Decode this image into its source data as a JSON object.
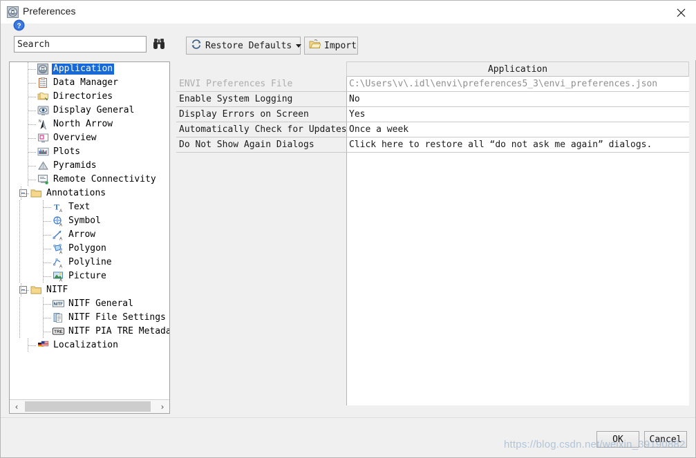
{
  "window": {
    "title": "Preferences",
    "icon": "envi-app-icon",
    "close_label": "×"
  },
  "search": {
    "value": "Search",
    "placeholder": "Search",
    "icon": "binoculars-icon"
  },
  "toolbar": {
    "restore_defaults_label": "Restore Defaults",
    "restore_defaults_icon": "refresh-icon",
    "import_label": "Import",
    "import_icon": "open-folder-icon"
  },
  "tree": {
    "items": [
      {
        "label": "Application",
        "icon": "envi-app-icon",
        "depth": 1,
        "selected": true,
        "expander": false
      },
      {
        "label": "Data Manager",
        "icon": "clipboard-icon",
        "depth": 1,
        "selected": false,
        "expander": false
      },
      {
        "label": "Directories",
        "icon": "folders-icon",
        "depth": 1,
        "selected": false,
        "expander": false
      },
      {
        "label": "Display General",
        "icon": "eye-monitor-icon",
        "depth": 1,
        "selected": false,
        "expander": false
      },
      {
        "label": "North Arrow",
        "icon": "north-arrow-icon",
        "depth": 1,
        "selected": false,
        "expander": false
      },
      {
        "label": "Overview",
        "icon": "overview-icon",
        "depth": 1,
        "selected": false,
        "expander": false
      },
      {
        "label": "Plots",
        "icon": "plots-icon",
        "depth": 1,
        "selected": false,
        "expander": false
      },
      {
        "label": "Pyramids",
        "icon": "pyramid-icon",
        "depth": 1,
        "selected": false,
        "expander": false
      },
      {
        "label": "Remote Connectivity",
        "icon": "remote-monitor-icon",
        "depth": 1,
        "selected": false,
        "expander": false
      },
      {
        "label": "Annotations",
        "icon": "folder-icon",
        "depth": 0,
        "selected": false,
        "expander": true
      },
      {
        "label": "Text",
        "icon": "text-annotation-icon",
        "depth": 2,
        "selected": false,
        "expander": false
      },
      {
        "label": "Symbol",
        "icon": "symbol-annotation-icon",
        "depth": 2,
        "selected": false,
        "expander": false
      },
      {
        "label": "Arrow",
        "icon": "arrow-annotation-icon",
        "depth": 2,
        "selected": false,
        "expander": false
      },
      {
        "label": "Polygon",
        "icon": "polygon-annotation-icon",
        "depth": 2,
        "selected": false,
        "expander": false
      },
      {
        "label": "Polyline",
        "icon": "polyline-annotation-icon",
        "depth": 2,
        "selected": false,
        "expander": false
      },
      {
        "label": "Picture",
        "icon": "picture-annotation-icon",
        "depth": 2,
        "selected": false,
        "expander": false
      },
      {
        "label": "NITF",
        "icon": "folder-icon",
        "depth": 0,
        "selected": false,
        "expander": true
      },
      {
        "label": "NITF General",
        "icon": "nitf-icon",
        "depth": 2,
        "selected": false,
        "expander": false
      },
      {
        "label": "NITF File Settings",
        "icon": "nitf-file-icon",
        "depth": 2,
        "selected": false,
        "expander": false
      },
      {
        "label": "NITF PIA TRE Metadata",
        "icon": "tre-icon",
        "depth": 2,
        "selected": false,
        "expander": false
      },
      {
        "label": "Localization",
        "icon": "flags-icon",
        "depth": 1,
        "selected": false,
        "expander": false
      }
    ],
    "hscroll": {
      "left_arrow": "‹",
      "right_arrow": "›"
    }
  },
  "preferences": {
    "column_header": "Application",
    "rows": [
      {
        "key": "ENVI Preferences File",
        "value": "C:\\Users\\v\\.idl\\envi\\preferences5_3\\envi_preferences.json",
        "disabled": true
      },
      {
        "key": "Enable System Logging",
        "value": "No",
        "disabled": false
      },
      {
        "key": "Display Errors on Screen",
        "value": "Yes",
        "disabled": false
      },
      {
        "key": "Automatically Check for Updates",
        "value": "Once a week",
        "disabled": false
      },
      {
        "key": "Do Not Show Again Dialogs",
        "value": "Click here to restore all “do not ask me again” dialogs.",
        "disabled": false
      }
    ]
  },
  "footer": {
    "help_icon": "help-circle-icon",
    "ok_label": "OK",
    "cancel_label": "Cancel",
    "watermark": "https://blog.csdn.net/weixin_39190882"
  },
  "colors": {
    "selection_blue": "#1669d6",
    "dialog_bg": "#f0f0f0",
    "panel_white": "#ffffff",
    "disabled_text": "#adadad"
  }
}
